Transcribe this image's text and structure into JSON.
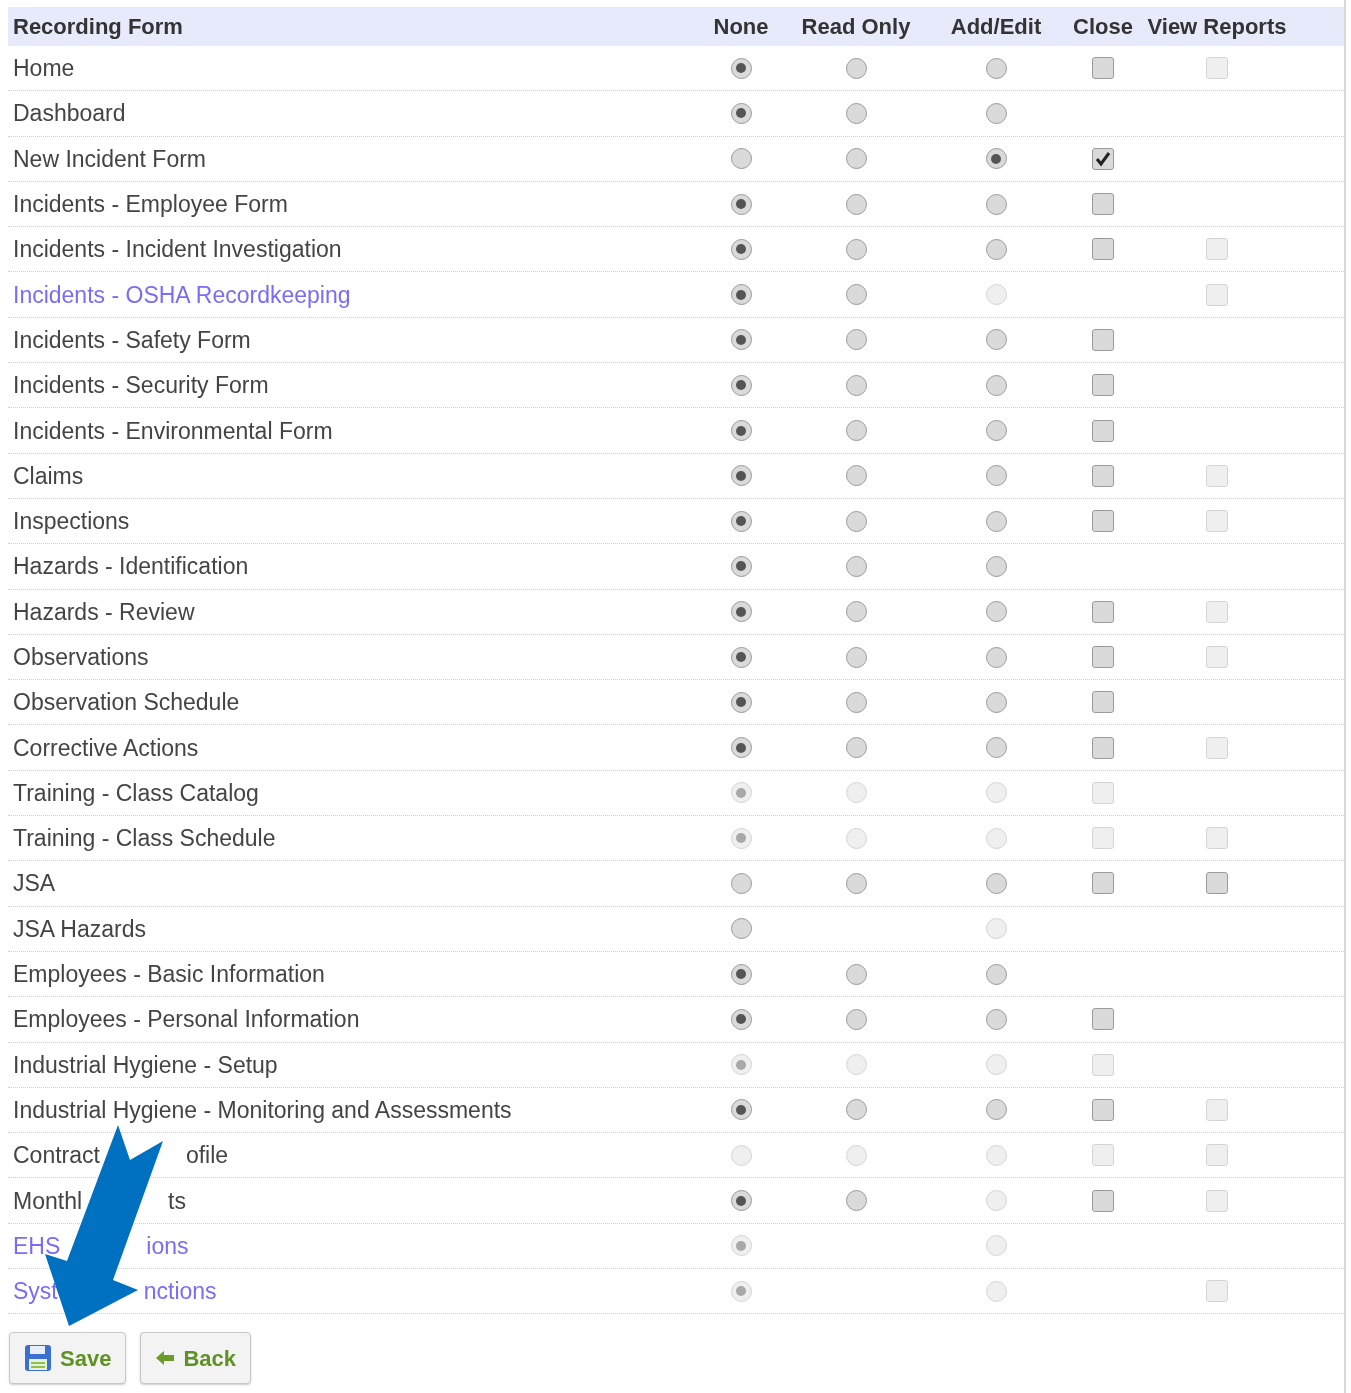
{
  "columns": [
    "Recording Form",
    "None",
    "Read Only",
    "Add/Edit",
    "Close",
    "View Reports"
  ],
  "rows": [
    {
      "label_parts": [
        "Home"
      ],
      "link": false,
      "cells": [
        {
          "kind": "radio",
          "selected": true,
          "disabled": false
        },
        {
          "kind": "radio",
          "selected": false,
          "disabled": false
        },
        {
          "kind": "radio",
          "selected": false,
          "disabled": false
        },
        {
          "kind": "checkbox",
          "checked": false,
          "disabled": false
        },
        {
          "kind": "checkbox",
          "checked": false,
          "disabled": true
        }
      ]
    },
    {
      "label_parts": [
        "Dashboard"
      ],
      "link": false,
      "cells": [
        {
          "kind": "radio",
          "selected": true,
          "disabled": false
        },
        {
          "kind": "radio",
          "selected": false,
          "disabled": false
        },
        {
          "kind": "radio",
          "selected": false,
          "disabled": false
        },
        {
          "kind": "blank"
        },
        {
          "kind": "blank"
        }
      ]
    },
    {
      "label_parts": [
        "New Incident Form"
      ],
      "link": false,
      "cells": [
        {
          "kind": "radio",
          "selected": false,
          "disabled": false
        },
        {
          "kind": "radio",
          "selected": false,
          "disabled": false
        },
        {
          "kind": "radio",
          "selected": true,
          "disabled": false
        },
        {
          "kind": "checkbox",
          "checked": true,
          "disabled": false
        },
        {
          "kind": "blank"
        }
      ]
    },
    {
      "label_parts": [
        "Incidents - Employee Form"
      ],
      "link": false,
      "cells": [
        {
          "kind": "radio",
          "selected": true,
          "disabled": false
        },
        {
          "kind": "radio",
          "selected": false,
          "disabled": false
        },
        {
          "kind": "radio",
          "selected": false,
          "disabled": false
        },
        {
          "kind": "checkbox",
          "checked": false,
          "disabled": false
        },
        {
          "kind": "blank"
        }
      ]
    },
    {
      "label_parts": [
        "Incidents - Incident Investigation"
      ],
      "link": false,
      "cells": [
        {
          "kind": "radio",
          "selected": true,
          "disabled": false
        },
        {
          "kind": "radio",
          "selected": false,
          "disabled": false
        },
        {
          "kind": "radio",
          "selected": false,
          "disabled": false
        },
        {
          "kind": "checkbox",
          "checked": false,
          "disabled": false
        },
        {
          "kind": "checkbox",
          "checked": false,
          "disabled": true
        }
      ]
    },
    {
      "label_parts": [
        "Incidents - OSHA Recordkeeping"
      ],
      "link": true,
      "cells": [
        {
          "kind": "radio",
          "selected": true,
          "disabled": false
        },
        {
          "kind": "radio",
          "selected": false,
          "disabled": false
        },
        {
          "kind": "radio",
          "selected": false,
          "disabled": true
        },
        {
          "kind": "blank"
        },
        {
          "kind": "checkbox",
          "checked": false,
          "disabled": true
        }
      ]
    },
    {
      "label_parts": [
        "Incidents - Safety Form"
      ],
      "link": false,
      "cells": [
        {
          "kind": "radio",
          "selected": true,
          "disabled": false
        },
        {
          "kind": "radio",
          "selected": false,
          "disabled": false
        },
        {
          "kind": "radio",
          "selected": false,
          "disabled": false
        },
        {
          "kind": "checkbox",
          "checked": false,
          "disabled": false
        },
        {
          "kind": "blank"
        }
      ]
    },
    {
      "label_parts": [
        "Incidents - Security Form"
      ],
      "link": false,
      "cells": [
        {
          "kind": "radio",
          "selected": true,
          "disabled": false
        },
        {
          "kind": "radio",
          "selected": false,
          "disabled": false
        },
        {
          "kind": "radio",
          "selected": false,
          "disabled": false
        },
        {
          "kind": "checkbox",
          "checked": false,
          "disabled": false
        },
        {
          "kind": "blank"
        }
      ]
    },
    {
      "label_parts": [
        "Incidents - Environmental Form"
      ],
      "link": false,
      "cells": [
        {
          "kind": "radio",
          "selected": true,
          "disabled": false
        },
        {
          "kind": "radio",
          "selected": false,
          "disabled": false
        },
        {
          "kind": "radio",
          "selected": false,
          "disabled": false
        },
        {
          "kind": "checkbox",
          "checked": false,
          "disabled": false
        },
        {
          "kind": "blank"
        }
      ]
    },
    {
      "label_parts": [
        "Claims"
      ],
      "link": false,
      "cells": [
        {
          "kind": "radio",
          "selected": true,
          "disabled": false
        },
        {
          "kind": "radio",
          "selected": false,
          "disabled": false
        },
        {
          "kind": "radio",
          "selected": false,
          "disabled": false
        },
        {
          "kind": "checkbox",
          "checked": false,
          "disabled": false
        },
        {
          "kind": "checkbox",
          "checked": false,
          "disabled": true
        }
      ]
    },
    {
      "label_parts": [
        "Inspections"
      ],
      "link": false,
      "cells": [
        {
          "kind": "radio",
          "selected": true,
          "disabled": false
        },
        {
          "kind": "radio",
          "selected": false,
          "disabled": false
        },
        {
          "kind": "radio",
          "selected": false,
          "disabled": false
        },
        {
          "kind": "checkbox",
          "checked": false,
          "disabled": false
        },
        {
          "kind": "checkbox",
          "checked": false,
          "disabled": true
        }
      ]
    },
    {
      "label_parts": [
        "Hazards - Identification"
      ],
      "link": false,
      "cells": [
        {
          "kind": "radio",
          "selected": true,
          "disabled": false
        },
        {
          "kind": "radio",
          "selected": false,
          "disabled": false
        },
        {
          "kind": "radio",
          "selected": false,
          "disabled": false
        },
        {
          "kind": "blank"
        },
        {
          "kind": "blank"
        }
      ]
    },
    {
      "label_parts": [
        "Hazards - Review"
      ],
      "link": false,
      "cells": [
        {
          "kind": "radio",
          "selected": true,
          "disabled": false
        },
        {
          "kind": "radio",
          "selected": false,
          "disabled": false
        },
        {
          "kind": "radio",
          "selected": false,
          "disabled": false
        },
        {
          "kind": "checkbox",
          "checked": false,
          "disabled": false
        },
        {
          "kind": "checkbox",
          "checked": false,
          "disabled": true
        }
      ]
    },
    {
      "label_parts": [
        "Observations"
      ],
      "link": false,
      "cells": [
        {
          "kind": "radio",
          "selected": true,
          "disabled": false
        },
        {
          "kind": "radio",
          "selected": false,
          "disabled": false
        },
        {
          "kind": "radio",
          "selected": false,
          "disabled": false
        },
        {
          "kind": "checkbox",
          "checked": false,
          "disabled": false
        },
        {
          "kind": "checkbox",
          "checked": false,
          "disabled": true
        }
      ]
    },
    {
      "label_parts": [
        "Observation Schedule"
      ],
      "link": false,
      "cells": [
        {
          "kind": "radio",
          "selected": true,
          "disabled": false
        },
        {
          "kind": "radio",
          "selected": false,
          "disabled": false
        },
        {
          "kind": "radio",
          "selected": false,
          "disabled": false
        },
        {
          "kind": "checkbox",
          "checked": false,
          "disabled": false
        },
        {
          "kind": "blank"
        }
      ]
    },
    {
      "label_parts": [
        "Corrective Actions"
      ],
      "link": false,
      "cells": [
        {
          "kind": "radio",
          "selected": true,
          "disabled": false
        },
        {
          "kind": "radio",
          "selected": false,
          "disabled": false
        },
        {
          "kind": "radio",
          "selected": false,
          "disabled": false
        },
        {
          "kind": "checkbox",
          "checked": false,
          "disabled": false
        },
        {
          "kind": "checkbox",
          "checked": false,
          "disabled": true
        }
      ]
    },
    {
      "label_parts": [
        "Training - Class Catalog"
      ],
      "link": false,
      "cells": [
        {
          "kind": "radio",
          "selected": true,
          "disabled": true
        },
        {
          "kind": "radio",
          "selected": false,
          "disabled": true
        },
        {
          "kind": "radio",
          "selected": false,
          "disabled": true
        },
        {
          "kind": "checkbox",
          "checked": false,
          "disabled": true
        },
        {
          "kind": "blank"
        }
      ]
    },
    {
      "label_parts": [
        "Training - Class Schedule"
      ],
      "link": false,
      "cells": [
        {
          "kind": "radio",
          "selected": true,
          "disabled": true
        },
        {
          "kind": "radio",
          "selected": false,
          "disabled": true
        },
        {
          "kind": "radio",
          "selected": false,
          "disabled": true
        },
        {
          "kind": "checkbox",
          "checked": false,
          "disabled": true
        },
        {
          "kind": "checkbox",
          "checked": false,
          "disabled": true
        }
      ]
    },
    {
      "label_parts": [
        "JSA"
      ],
      "link": false,
      "cells": [
        {
          "kind": "radio",
          "selected": false,
          "disabled": false
        },
        {
          "kind": "radio",
          "selected": false,
          "disabled": false
        },
        {
          "kind": "radio",
          "selected": false,
          "disabled": false
        },
        {
          "kind": "checkbox",
          "checked": false,
          "disabled": false
        },
        {
          "kind": "checkbox",
          "checked": false,
          "disabled": false
        }
      ]
    },
    {
      "label_parts": [
        "JSA Hazards"
      ],
      "link": false,
      "cells": [
        {
          "kind": "radio",
          "selected": false,
          "disabled": false
        },
        {
          "kind": "blank"
        },
        {
          "kind": "radio",
          "selected": false,
          "disabled": true
        },
        {
          "kind": "blank"
        },
        {
          "kind": "blank"
        }
      ]
    },
    {
      "label_parts": [
        "Employees - Basic Information"
      ],
      "link": false,
      "cells": [
        {
          "kind": "radio",
          "selected": true,
          "disabled": false
        },
        {
          "kind": "radio",
          "selected": false,
          "disabled": false
        },
        {
          "kind": "radio",
          "selected": false,
          "disabled": false
        },
        {
          "kind": "blank"
        },
        {
          "kind": "blank"
        }
      ]
    },
    {
      "label_parts": [
        "Employees - Personal Information"
      ],
      "link": false,
      "cells": [
        {
          "kind": "radio",
          "selected": true,
          "disabled": false
        },
        {
          "kind": "radio",
          "selected": false,
          "disabled": false
        },
        {
          "kind": "radio",
          "selected": false,
          "disabled": false
        },
        {
          "kind": "checkbox",
          "checked": false,
          "disabled": false
        },
        {
          "kind": "blank"
        }
      ]
    },
    {
      "label_parts": [
        "Industrial Hygiene - Setup"
      ],
      "link": false,
      "cells": [
        {
          "kind": "radio",
          "selected": true,
          "disabled": true
        },
        {
          "kind": "radio",
          "selected": false,
          "disabled": true
        },
        {
          "kind": "radio",
          "selected": false,
          "disabled": true
        },
        {
          "kind": "checkbox",
          "checked": false,
          "disabled": true
        },
        {
          "kind": "blank"
        }
      ]
    },
    {
      "label_parts": [
        "Industrial Hygiene - Monitoring and Assessments"
      ],
      "link": false,
      "cells": [
        {
          "kind": "radio",
          "selected": true,
          "disabled": false
        },
        {
          "kind": "radio",
          "selected": false,
          "disabled": false
        },
        {
          "kind": "radio",
          "selected": false,
          "disabled": false
        },
        {
          "kind": "checkbox",
          "checked": false,
          "disabled": false
        },
        {
          "kind": "checkbox",
          "checked": false,
          "disabled": true
        }
      ]
    },
    {
      "label_parts": [
        "Contract",
        "ofile"
      ],
      "link": false,
      "cells": [
        {
          "kind": "radio",
          "selected": false,
          "disabled": true
        },
        {
          "kind": "radio",
          "selected": false,
          "disabled": true
        },
        {
          "kind": "radio",
          "selected": false,
          "disabled": true
        },
        {
          "kind": "checkbox",
          "checked": false,
          "disabled": true
        },
        {
          "kind": "checkbox",
          "checked": false,
          "disabled": true
        }
      ]
    },
    {
      "label_parts": [
        "Monthl",
        "ts"
      ],
      "link": false,
      "cells": [
        {
          "kind": "radio",
          "selected": true,
          "disabled": false
        },
        {
          "kind": "radio",
          "selected": false,
          "disabled": false
        },
        {
          "kind": "radio",
          "selected": false,
          "disabled": true
        },
        {
          "kind": "checkbox",
          "checked": false,
          "disabled": false
        },
        {
          "kind": "checkbox",
          "checked": false,
          "disabled": true
        }
      ]
    },
    {
      "label_parts": [
        "EHS",
        "ions"
      ],
      "link": true,
      "cells": [
        {
          "kind": "radio",
          "selected": true,
          "disabled": true
        },
        {
          "kind": "blank"
        },
        {
          "kind": "radio",
          "selected": false,
          "disabled": true
        },
        {
          "kind": "blank"
        },
        {
          "kind": "blank"
        }
      ]
    },
    {
      "label_parts": [
        "Syst",
        "nctions"
      ],
      "link": true,
      "cells": [
        {
          "kind": "radio",
          "selected": true,
          "disabled": true
        },
        {
          "kind": "blank"
        },
        {
          "kind": "radio",
          "selected": false,
          "disabled": true
        },
        {
          "kind": "blank"
        },
        {
          "kind": "checkbox",
          "checked": false,
          "disabled": true
        }
      ]
    }
  ],
  "buttons": [
    {
      "kind": "save",
      "label": "Save"
    },
    {
      "kind": "back",
      "label": "Back"
    }
  ]
}
